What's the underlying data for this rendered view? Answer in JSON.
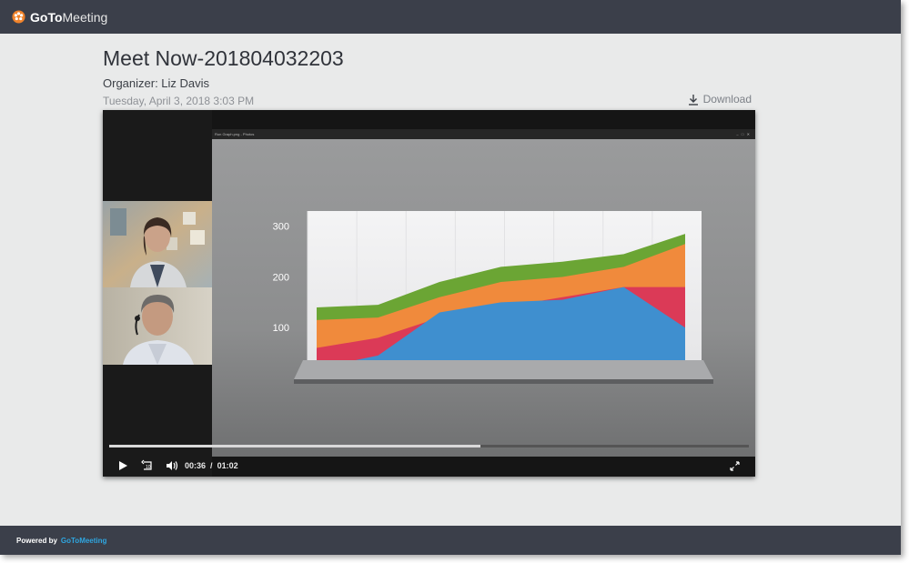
{
  "app": {
    "logo_goto": "GoTo",
    "logo_meeting": "Meeting"
  },
  "meeting": {
    "title": "Meet Now-201804032203",
    "organizer": "Organizer: Liz Davis",
    "datetime": "Tuesday, April 3, 2018 3:03 PM",
    "download_label": "Download"
  },
  "player": {
    "shared_window_title": "Run Graph.png - Photos",
    "current_time": "00:36",
    "separator": "/",
    "duration": "01:02",
    "progress_fraction": 0.58,
    "icons": [
      "play-icon",
      "rewind-10-icon",
      "volume-icon",
      "fullscreen-icon"
    ]
  },
  "chart_data": {
    "type": "area",
    "x": [
      1,
      2,
      3,
      4,
      5,
      6,
      7
    ],
    "yticks": [
      "100",
      "200",
      "300"
    ],
    "series": [
      {
        "color": "#3f8fcf",
        "values": [
          20,
          45,
          130,
          150,
          155,
          180,
          100
        ]
      },
      {
        "color": "#db3a57",
        "values": [
          60,
          80,
          120,
          140,
          160,
          180,
          180
        ]
      },
      {
        "color": "#f08a3c",
        "values": [
          115,
          120,
          160,
          190,
          200,
          220,
          265
        ]
      },
      {
        "color": "#6ba534",
        "values": [
          140,
          145,
          190,
          220,
          230,
          245,
          285
        ]
      }
    ]
  },
  "footer": {
    "powered_by": "Powered by",
    "brand": "GoToMeeting"
  },
  "colors": {
    "header_bg": "#3b3f4a",
    "page_bg": "#e9eaea",
    "logo_orange": "#f0832b",
    "brand_blue": "#2fa6e0"
  }
}
